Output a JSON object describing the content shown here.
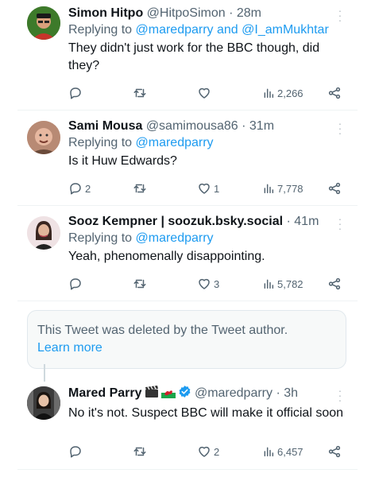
{
  "tweets": [
    {
      "name": "Simon Hitpo",
      "handle": "@HitpoSimon",
      "dot": "·",
      "time": "28m",
      "reply_prefix": "Replying to",
      "reply_to_1": "@maredparry",
      "reply_join": "and",
      "reply_to_2": "@I_amMukhtar",
      "text": "They didn't just work for the BBC though, did they?",
      "replies": "",
      "retweets": "",
      "likes": "",
      "views": "2,266"
    },
    {
      "name": "Sami Mousa",
      "handle": "@samimousa86",
      "dot": "·",
      "time": "31m",
      "reply_prefix": "Replying to",
      "reply_to_1": "@maredparry",
      "text": "Is it Huw Edwards?",
      "replies": "2",
      "retweets": "",
      "likes": "1",
      "views": "7,778"
    },
    {
      "name": "Sooz Kempner | soozuk.bsky.social",
      "handle": "",
      "dot": "·",
      "time": "41m",
      "reply_prefix": "Replying to",
      "reply_to_1": "@maredparry",
      "text": "Yeah, phenomenally disappointing.",
      "replies": "",
      "retweets": "",
      "likes": "3",
      "views": "5,782"
    },
    {
      "name": "Mared Parry",
      "handle": "@maredparry",
      "dot": "·",
      "time": "3h",
      "text": "No it's not. Suspect BBC will make it official soon",
      "replies": "",
      "retweets": "",
      "likes": "2",
      "views": "6,457"
    }
  ],
  "deleted_notice": {
    "text": "This Tweet was deleted by the Tweet author.",
    "link": "Learn more"
  },
  "colors": {
    "accent": "#1d9bf0",
    "muted": "#536471",
    "verified": "#1d9bf0"
  },
  "icons": {
    "reply": "reply-icon",
    "retweet": "retweet-icon",
    "like": "heart-icon",
    "views": "views-icon",
    "share": "share-icon",
    "more": "more-icon"
  }
}
